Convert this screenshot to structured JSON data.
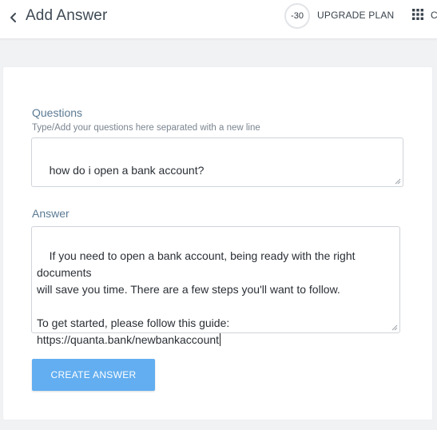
{
  "header": {
    "title": "Add Answer",
    "back_icon": "chevron-left-icon",
    "credits": "-30",
    "upgrade_label": "UPGRADE PLAN",
    "apps_icon": "grid-icon",
    "apps_label": "C"
  },
  "form": {
    "questions_label": "Questions",
    "questions_hint": "Type/Add your questions here separated with a new line",
    "questions_value": "how do i open a bank account?",
    "answer_label": "Answer",
    "answer_value": "If you need to open a bank account, being ready with the right documents\nwill save you time. There are a few steps you'll want to follow.\n\nTo get started, please follow this guide:\nhttps://quanta.bank/newbankaccount",
    "submit_label": "CREATE ANSWER"
  },
  "colors": {
    "accent": "#62aef0",
    "label": "#5b7a93",
    "background": "#f1f2f4"
  }
}
